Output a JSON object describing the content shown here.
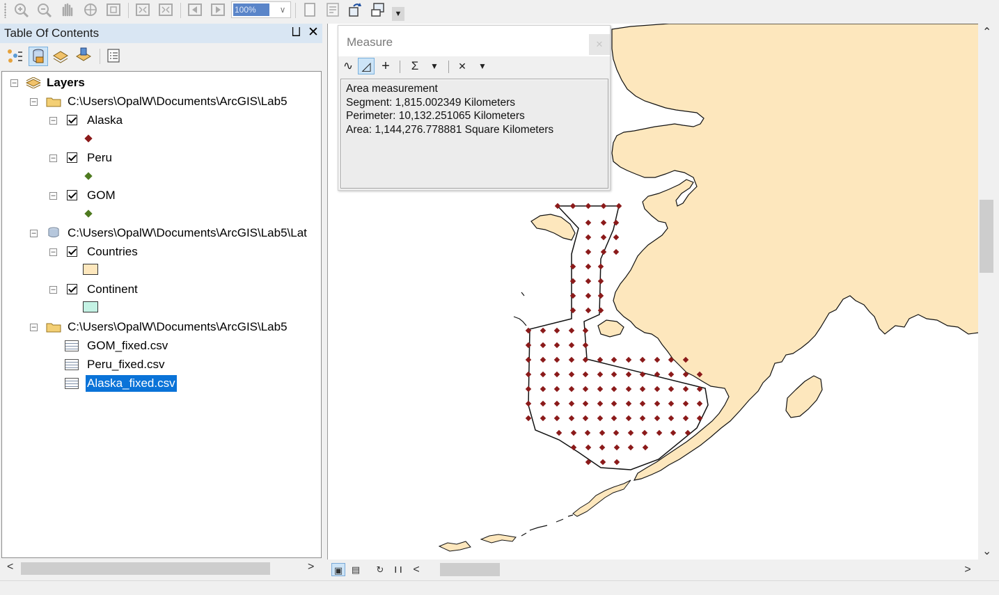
{
  "toolbar": {
    "zoom_value": "100%",
    "buttons": [
      "zoom-in-icon",
      "zoom-out-icon",
      "pan-icon",
      "full-extent-icon",
      "fixed-zoom-icon",
      "zoom-in-fixed-icon",
      "zoom-out-fixed-icon",
      "back-icon",
      "forward-icon",
      "page-icon",
      "toggle-icon",
      "refresh-icon",
      "tools-icon"
    ]
  },
  "toc": {
    "title": "Table Of Contents",
    "pin_icon": "⨆",
    "close_icon": "✕",
    "tree": {
      "root_label": "Layers",
      "groups": [
        {
          "path": "C:\\Users\\OpalW\\Documents\\ArcGIS\\Lab5",
          "type": "folder",
          "layers": [
            {
              "label": "Alaska",
              "symbol": "point",
              "color": "#8b1a1a"
            },
            {
              "label": "Peru",
              "symbol": "point",
              "color": "#4e7a20"
            },
            {
              "label": "GOM",
              "symbol": "point",
              "color": "#4e7a20"
            }
          ]
        },
        {
          "path": "C:\\Users\\OpalW\\Documents\\ArcGIS\\Lab5\\Lat",
          "type": "database",
          "layers": [
            {
              "label": "Countries",
              "symbol": "polygon",
              "color": "#fde7bd"
            },
            {
              "label": "Continent",
              "symbol": "polygon",
              "color": "#c4f2e4"
            }
          ]
        },
        {
          "path": "C:\\Users\\OpalW\\Documents\\ArcGIS\\Lab5",
          "type": "folder",
          "tables": [
            "GOM_fixed.csv",
            "Peru_fixed.csv",
            "Alaska_fixed.csv"
          ],
          "selected_table": "Alaska_fixed.csv"
        }
      ]
    }
  },
  "measure": {
    "title": "Measure",
    "close_icon": "✕",
    "tools": {
      "line": "∿",
      "area": "◿",
      "feature": "+",
      "sum": "Σ",
      "dropdown": "▼",
      "clear": "✕"
    },
    "results": {
      "heading": "Area measurement",
      "segment": "Segment: 1,815.002349 Kilometers",
      "perimeter": "Perimeter: 10,132.251065 Kilometers",
      "area": "Area: 1,144,276.778881 Square Kilometers"
    }
  },
  "map": {
    "land_color": "#fde7bd",
    "point_color": "#8b1a1a",
    "scroll_up": "⌃",
    "scroll_down": "⌄",
    "scroll_left": "<",
    "scroll_right": ">"
  },
  "statusbar": {
    "data_view_icon": "▣",
    "layout_view_icon": "▤",
    "refresh_icon": "↻",
    "pause_icon": "❙❙",
    "left_arrow": "<",
    "right_arrow": ">"
  }
}
